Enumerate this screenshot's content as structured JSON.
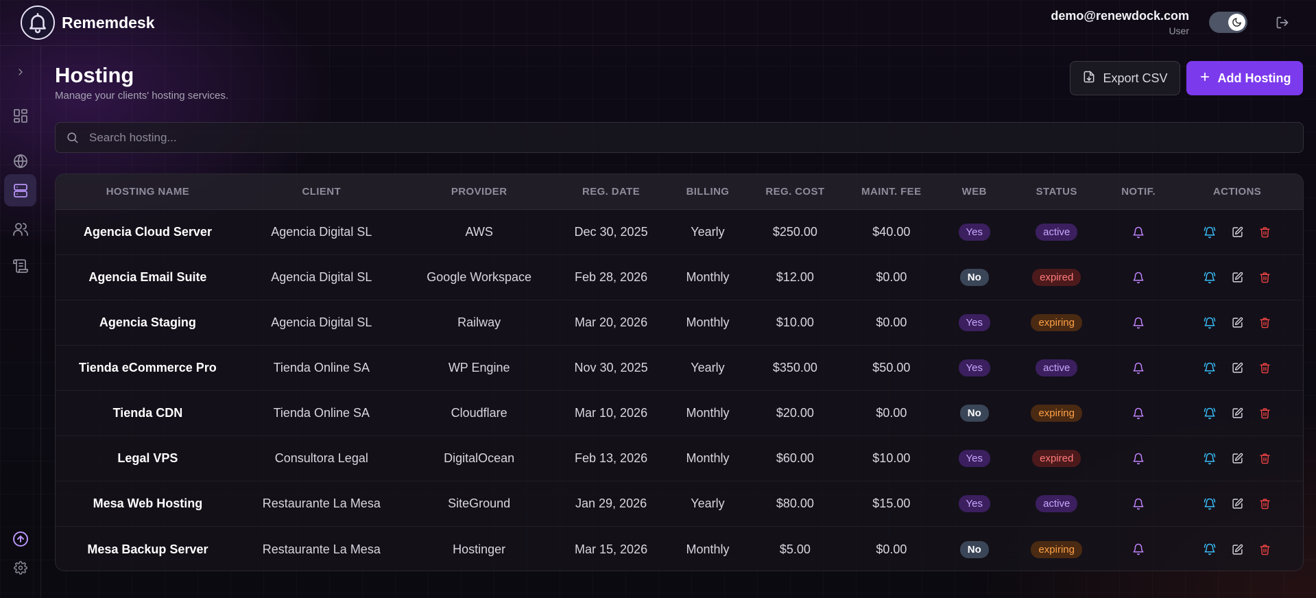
{
  "app": {
    "name": "Rememdesk"
  },
  "user": {
    "email": "demo@renewdock.com",
    "role": "User"
  },
  "page": {
    "title": "Hosting",
    "subtitle": "Manage your clients' hosting services."
  },
  "toolbar": {
    "export_label": "Export CSV",
    "add_label": "Add Hosting"
  },
  "search": {
    "placeholder": "Search hosting..."
  },
  "colors": {
    "accent": "#7c3aed",
    "active": "#c9a6ff",
    "expired": "#ff7a7a",
    "expiring": "#ffa046",
    "notify": "#c084fc",
    "remind": "#38bdf8",
    "delete": "#ef4444"
  },
  "table": {
    "headers": [
      "HOSTING NAME",
      "CLIENT",
      "PROVIDER",
      "REG. DATE",
      "BILLING",
      "REG. COST",
      "MAINT. FEE",
      "WEB",
      "STATUS",
      "NOTIF.",
      "ACTIONS"
    ],
    "rows": [
      {
        "name": "Agencia Cloud Server",
        "client": "Agencia Digital SL",
        "provider": "AWS",
        "reg_date": "Dec 30, 2025",
        "billing": "Yearly",
        "reg_cost": "$250.00",
        "maint_fee": "$40.00",
        "web": "Yes",
        "status": "active"
      },
      {
        "name": "Agencia Email Suite",
        "client": "Agencia Digital SL",
        "provider": "Google Workspace",
        "reg_date": "Feb 28, 2026",
        "billing": "Monthly",
        "reg_cost": "$12.00",
        "maint_fee": "$0.00",
        "web": "No",
        "status": "expired"
      },
      {
        "name": "Agencia Staging",
        "client": "Agencia Digital SL",
        "provider": "Railway",
        "reg_date": "Mar 20, 2026",
        "billing": "Monthly",
        "reg_cost": "$10.00",
        "maint_fee": "$0.00",
        "web": "Yes",
        "status": "expiring"
      },
      {
        "name": "Tienda eCommerce Pro",
        "client": "Tienda Online SA",
        "provider": "WP Engine",
        "reg_date": "Nov 30, 2025",
        "billing": "Yearly",
        "reg_cost": "$350.00",
        "maint_fee": "$50.00",
        "web": "Yes",
        "status": "active"
      },
      {
        "name": "Tienda CDN",
        "client": "Tienda Online SA",
        "provider": "Cloudflare",
        "reg_date": "Mar 10, 2026",
        "billing": "Monthly",
        "reg_cost": "$20.00",
        "maint_fee": "$0.00",
        "web": "No",
        "status": "expiring"
      },
      {
        "name": "Legal VPS",
        "client": "Consultora Legal",
        "provider": "DigitalOcean",
        "reg_date": "Feb 13, 2026",
        "billing": "Monthly",
        "reg_cost": "$60.00",
        "maint_fee": "$10.00",
        "web": "Yes",
        "status": "expired"
      },
      {
        "name": "Mesa Web Hosting",
        "client": "Restaurante La Mesa",
        "provider": "SiteGround",
        "reg_date": "Jan 29, 2026",
        "billing": "Yearly",
        "reg_cost": "$80.00",
        "maint_fee": "$15.00",
        "web": "Yes",
        "status": "active"
      },
      {
        "name": "Mesa Backup Server",
        "client": "Restaurante La Mesa",
        "provider": "Hostinger",
        "reg_date": "Mar 15, 2026",
        "billing": "Monthly",
        "reg_cost": "$5.00",
        "maint_fee": "$0.00",
        "web": "No",
        "status": "expiring"
      }
    ]
  }
}
